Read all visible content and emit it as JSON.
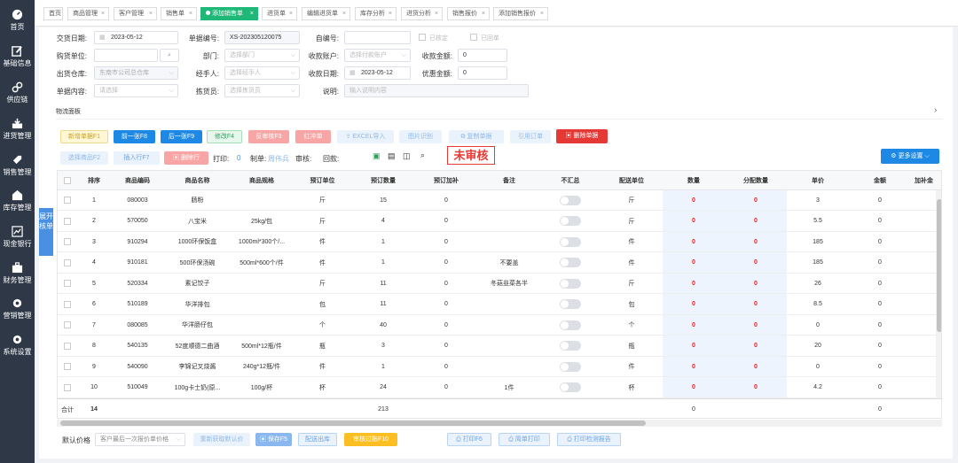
{
  "sidebar": {
    "items": [
      {
        "label": "首页",
        "icon": "dashboard-icon"
      },
      {
        "label": "基础信息",
        "icon": "edit-icon"
      },
      {
        "label": "供应链",
        "icon": "link-icon"
      },
      {
        "label": "进货管理",
        "icon": "inbox-icon"
      },
      {
        "label": "销售管理",
        "icon": "tag-icon"
      },
      {
        "label": "库存管理",
        "icon": "warehouse-icon"
      },
      {
        "label": "现金银行",
        "icon": "chart-icon"
      },
      {
        "label": "财务管理",
        "icon": "briefcase-icon"
      },
      {
        "label": "营销管理",
        "icon": "gear-icon"
      },
      {
        "label": "系统设置",
        "icon": "gear-icon"
      }
    ]
  },
  "tabs": [
    {
      "label": "首页"
    },
    {
      "label": "商品管理"
    },
    {
      "label": "客户管理"
    },
    {
      "label": "销售单"
    },
    {
      "label": "添加销售单",
      "active": true
    },
    {
      "label": "进货单"
    },
    {
      "label": "编辑进货单"
    },
    {
      "label": "库存分析"
    },
    {
      "label": "进货分析"
    },
    {
      "label": "销售报价"
    },
    {
      "label": "添加销售报价"
    }
  ],
  "tab_close": "×",
  "form": {
    "date_label": "交货日期:",
    "date_value": "2023-05-12",
    "docno_label": "单据编号:",
    "docno_value": "XS-202305120075",
    "selfno_label": "自编号:",
    "selfno_value": "",
    "checked_label": "已核定",
    "returned_label": "已回单",
    "buyer_label": "购货单位:",
    "buyer_value": "",
    "dept_label": "部门:",
    "dept_placeholder": "选择部门",
    "account_label": "收款账户:",
    "account_placeholder": "选择付款账户",
    "amount_label": "收款金额:",
    "amount_value": "0",
    "warehouse_label": "出货仓库:",
    "warehouse_value": "东南市公司总仓库",
    "handler_label": "经手人:",
    "handler_placeholder": "选择经手人",
    "paydate_label": "收款日期:",
    "paydate_value": "2023-05-12",
    "discount_label": "优惠金额:",
    "discount_value": "0",
    "content_label": "单据内容:",
    "content_placeholder": "请选择",
    "picker_label": "拣货员:",
    "picker_placeholder": "选择拣货员",
    "note_label": "说明:",
    "note_placeholder": "输入说明内容"
  },
  "logistics_label": "物流面板",
  "expand_label": "›",
  "toolbar1": {
    "new": "新增单据F1",
    "prev": "前一张F8",
    "next": "后一张F9",
    "edit": "修改F4",
    "reverse": "反审核F3",
    "redflush": "红冲单",
    "excel": "EXCEL导入",
    "image": "图片识别",
    "copy": "复制单据",
    "ref": "引用订单",
    "delete": "删除单据"
  },
  "toolbar2": {
    "select": "选择商品F2",
    "insert": "插入行F7",
    "delrow": "删除行",
    "print_label": "打印:",
    "print_count": "0",
    "maker_label": "制单:",
    "maker_value": "周伟兵",
    "audit_label": "审核:",
    "return_label": "回款:",
    "status": "未审核",
    "more": "更多设置"
  },
  "side_tab": "展开核单",
  "table": {
    "headers": [
      "",
      "排序",
      "商品编码",
      "商品名称",
      "商品规格",
      "预订单位",
      "预订数量",
      "预订加补",
      "备注",
      "不汇总",
      "配送单位",
      "数量",
      "分配数量",
      "单价",
      "金额",
      "加补金"
    ],
    "rows": [
      {
        "idx": "1",
        "code": "080003",
        "name": "肠粉",
        "spec": "",
        "unit": "斤",
        "qty": "15",
        "add": "0",
        "note": "",
        "dunit": "斤",
        "num": "0",
        "alloc": "0",
        "price": "3",
        "amount": "0"
      },
      {
        "idx": "2",
        "code": "570050",
        "name": "八宝米",
        "spec": "25kg/包",
        "unit": "斤",
        "qty": "4",
        "add": "0",
        "note": "",
        "dunit": "斤",
        "num": "0",
        "alloc": "0",
        "price": "5.5",
        "amount": "0"
      },
      {
        "idx": "3",
        "code": "910294",
        "name": "1000环保饭盒",
        "spec": "1000ml*300个/...",
        "unit": "件",
        "qty": "1",
        "add": "0",
        "note": "",
        "dunit": "件",
        "num": "0",
        "alloc": "0",
        "price": "185",
        "amount": "0"
      },
      {
        "idx": "4",
        "code": "910181",
        "name": "500环保汤碗",
        "spec": "500ml*600个/件",
        "unit": "件",
        "qty": "1",
        "add": "0",
        "note": "不要盖",
        "dunit": "件",
        "num": "0",
        "alloc": "0",
        "price": "185",
        "amount": "0"
      },
      {
        "idx": "5",
        "code": "520334",
        "name": "素记饺子",
        "spec": "",
        "unit": "斤",
        "qty": "11",
        "add": "0",
        "note": "冬菇韭菜各半",
        "dunit": "斤",
        "num": "0",
        "alloc": "0",
        "price": "26",
        "amount": "0"
      },
      {
        "idx": "6",
        "code": "510189",
        "name": "华洋排包",
        "spec": "",
        "unit": "包",
        "qty": "11",
        "add": "0",
        "note": "",
        "dunit": "包",
        "num": "0",
        "alloc": "0",
        "price": "8.5",
        "amount": "0"
      },
      {
        "idx": "7",
        "code": "080085",
        "name": "华洋肠仔包",
        "spec": "",
        "unit": "个",
        "qty": "40",
        "add": "0",
        "note": "",
        "dunit": "个",
        "num": "0",
        "alloc": "0",
        "price": "0",
        "amount": "0"
      },
      {
        "idx": "8",
        "code": "540135",
        "name": "52度顺德二曲酒",
        "spec": "500ml*12瓶/件",
        "unit": "瓶",
        "qty": "3",
        "add": "0",
        "note": "",
        "dunit": "瓶",
        "num": "0",
        "alloc": "0",
        "price": "20",
        "amount": "0"
      },
      {
        "idx": "9",
        "code": "540090",
        "name": "李锦记叉烧酱",
        "spec": "240g*12瓶/件",
        "unit": "件",
        "qty": "1",
        "add": "0",
        "note": "",
        "dunit": "件",
        "num": "0",
        "alloc": "0",
        "price": "0",
        "amount": "0"
      },
      {
        "idx": "10",
        "code": "510049",
        "name": "100g卡士奶(原...",
        "spec": "100g/杯",
        "unit": "杯",
        "qty": "24",
        "add": "0",
        "note": "1件",
        "dunit": "杯",
        "num": "0",
        "alloc": "0",
        "price": "4.2",
        "amount": "0"
      }
    ],
    "sum": {
      "label": "合计",
      "count": "14",
      "qty": "213",
      "num": "0",
      "amount": "0"
    }
  },
  "footer": {
    "price_label": "默认价格",
    "price_value": "客户最后一次报价单价格",
    "reget": "重新获取默认价",
    "save": "保存F5",
    "ship": "配送出库",
    "submit": "审核过账F10",
    "print": "打印F6",
    "quick_print": "简单打印",
    "print_report": "打印检测报告"
  }
}
